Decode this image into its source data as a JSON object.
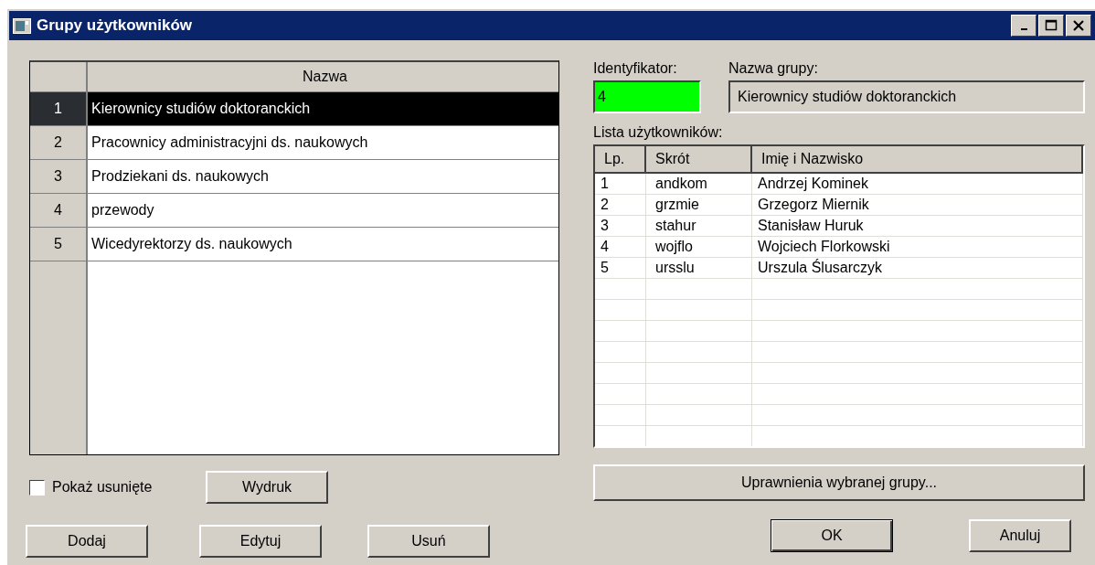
{
  "window": {
    "title": "Grupy użytkowników"
  },
  "groups_table": {
    "columns": [
      "Nazwa"
    ],
    "rows": [
      {
        "number": "1",
        "name": "Kierownicy studiów doktoranckich",
        "selected": true
      },
      {
        "number": "2",
        "name": "Pracownicy administracyjni ds. naukowych",
        "selected": false
      },
      {
        "number": "3",
        "name": "Prodziekani ds. naukowych",
        "selected": false
      },
      {
        "number": "4",
        "name": "przewody",
        "selected": false
      },
      {
        "number": "5",
        "name": "Wicedyrektorzy ds. naukowych",
        "selected": false
      }
    ]
  },
  "identifier": {
    "label": "Identyfikator:",
    "value": "4"
  },
  "group_name": {
    "label": "Nazwa grupy:",
    "value": "Kierownicy studiów doktoranckich"
  },
  "users": {
    "label": "Lista użytkowników:",
    "columns": [
      "Lp.",
      "Skrót",
      "Imię i Nazwisko"
    ],
    "rows": [
      [
        "1",
        "andkom",
        "Andrzej Kominek"
      ],
      [
        "2",
        "grzmie",
        "Grzegorz Miernik"
      ],
      [
        "3",
        "stahur",
        "Stanisław Huruk"
      ],
      [
        "4",
        "wojflo",
        "Wojciech Florkowski"
      ],
      [
        "5",
        "ursslu",
        "Urszula Ślusarczyk"
      ]
    ]
  },
  "show_deleted": {
    "label": "Pokaż usunięte",
    "checked": false
  },
  "print_button": "Wydruk",
  "permissions_button": "Uprawnienia wybranej grupy...",
  "left_buttons": [
    "Dodaj",
    "Edytuj",
    "Usuń"
  ],
  "ok_button": "OK",
  "cancel_button": "Anuluj"
}
